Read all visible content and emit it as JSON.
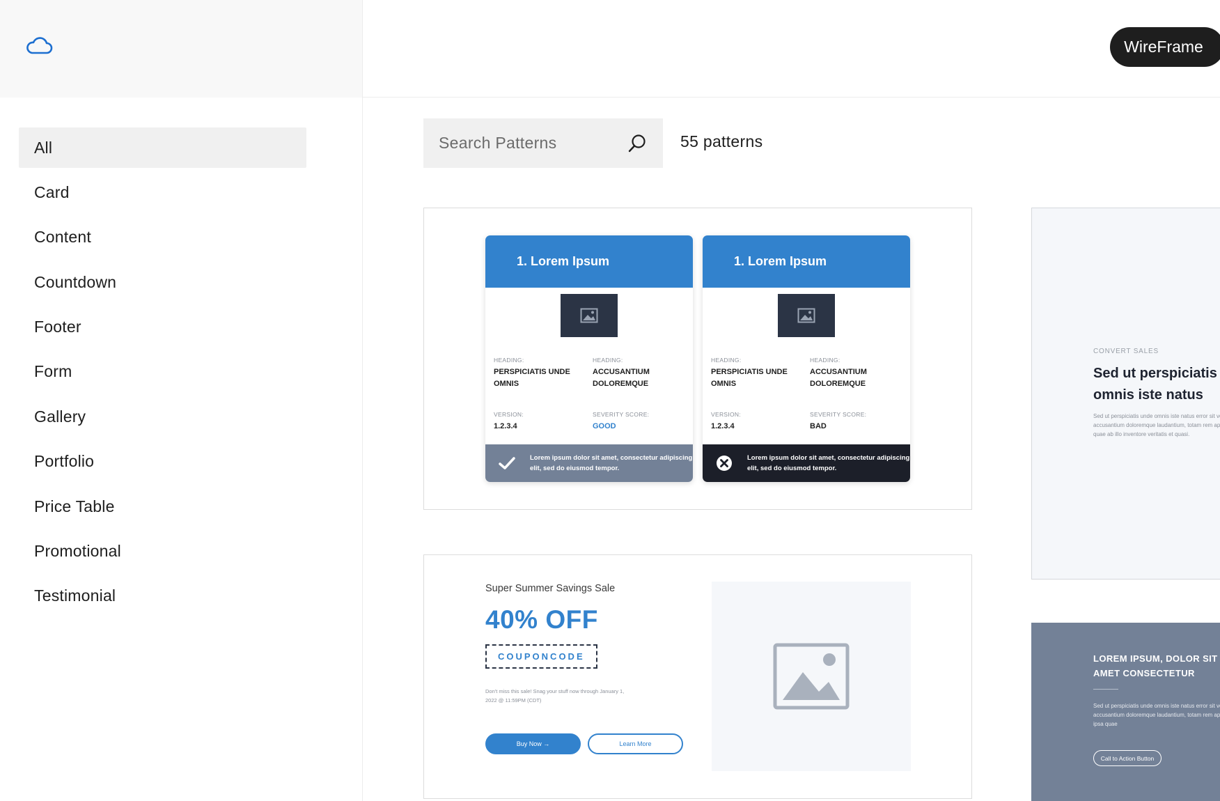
{
  "sidebar": {
    "logo": "cloud-icon",
    "categories": [
      {
        "label": "All",
        "active": true
      },
      {
        "label": "Card"
      },
      {
        "label": "Content"
      },
      {
        "label": "Countdown"
      },
      {
        "label": "Footer"
      },
      {
        "label": "Form"
      },
      {
        "label": "Gallery"
      },
      {
        "label": "Portfolio"
      },
      {
        "label": "Price Table"
      },
      {
        "label": "Promotional"
      },
      {
        "label": "Testimonial"
      }
    ]
  },
  "header": {
    "mode_button": "WireFrame"
  },
  "search": {
    "placeholder": "Search Patterns",
    "count": "55 patterns"
  },
  "patterns": {
    "cards": {
      "left": {
        "title": "1. Lorem Ipsum",
        "heading1_label": "HEADING:",
        "heading1_value": "PERSPICIATIS UNDE OMNIS",
        "heading2_label": "HEADING:",
        "heading2_value": "ACCUSANTIUM DOLOREMQUE",
        "version_label": "VERSION:",
        "version_value": "1.2.3.4",
        "score_label": "SEVERITY SCORE:",
        "score_value": "GOOD",
        "footer": "Lorem ipsum dolor sit amet, consectetur adipiscing elit, sed do eiusmod tempor."
      },
      "right": {
        "title": "1. Lorem Ipsum",
        "heading1_label": "HEADING:",
        "heading1_value": "PERSPICIATIS UNDE OMNIS",
        "heading2_label": "HEADING:",
        "heading2_value": "ACCUSANTIUM DOLOREMQUE",
        "version_label": "VERSION:",
        "version_value": "1.2.3.4",
        "score_label": "SEVERITY SCORE:",
        "score_value": "BAD",
        "footer": "Lorem ipsum dolor sit amet, consectetur adipiscing elit, sed do eiusmod tempor."
      }
    },
    "promo": {
      "subtitle": "Super Summer Savings Sale",
      "title": "40% OFF",
      "coupon": "COUPONCODE",
      "note": "Don't miss this sale! Snag your stuff now through January 1, 2022 @ 11:59PM (CDT)",
      "buy_button": "Buy Now →",
      "learn_button": "Learn More"
    },
    "content": {
      "eyebrow": "CONVERT SALES",
      "heading": "Sed ut perspiciatis unde omnis iste natus",
      "body": "Sed ut perspiciatis unde omnis iste natus error sit voluptatem accusantium doloremque laudantium, totam rem aperiam, eaque ipsa quae ab illo inventore veritatis et quasi."
    },
    "cta": {
      "heading": "LOREM IPSUM, DOLOR SIT AMET CONSECTETUR",
      "body": "Sed ut perspiciatis unde omnis iste natus error sit voluptatem accusantium doloremque laudantium, totam rem aperiam, eaque ipsa quae",
      "button": "Call to Action Button"
    }
  },
  "colors": {
    "accent": "#3282cd",
    "dark": "#1e1e1e",
    "slate": "#738197",
    "navy": "#1c1f29"
  }
}
